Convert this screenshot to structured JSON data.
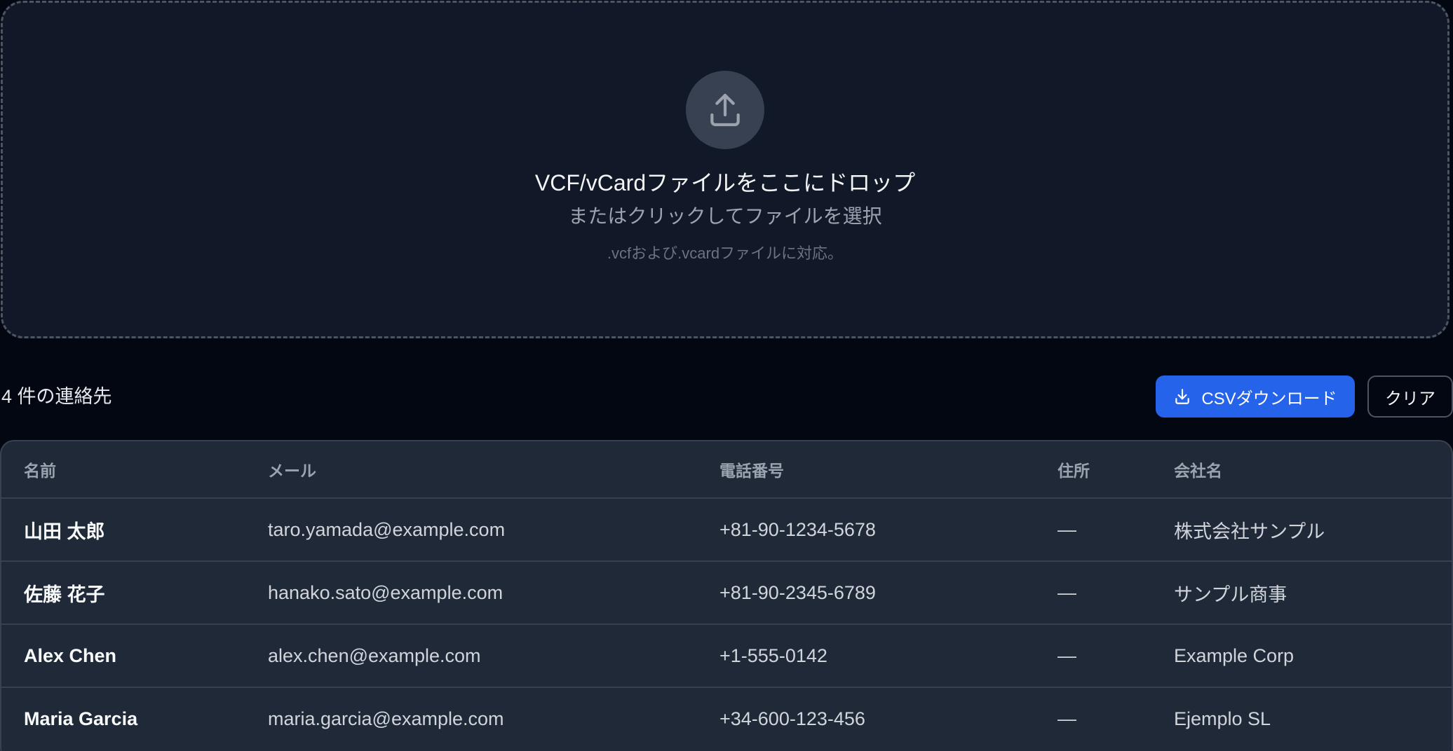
{
  "dropzone": {
    "title": "VCF/vCardファイルをここにドロップ",
    "subtitle": "またはクリックしてファイルを選択",
    "hint": ".vcfおよび.vcardファイルに対応。",
    "icon": "upload-icon"
  },
  "toolbar": {
    "count_label": "4 件の連絡先",
    "download_label": "CSVダウンロード",
    "download_icon": "download-icon",
    "clear_label": "クリア"
  },
  "table": {
    "columns": [
      "名前",
      "メール",
      "電話番号",
      "住所",
      "会社名"
    ],
    "rows": [
      {
        "name": "山田 太郎",
        "email": "taro.yamada@example.com",
        "phone": "+81-90-1234-5678",
        "address": "—",
        "company": "株式会社サンプル"
      },
      {
        "name": "佐藤 花子",
        "email": "hanako.sato@example.com",
        "phone": "+81-90-2345-6789",
        "address": "—",
        "company": "サンプル商事"
      },
      {
        "name": "Alex Chen",
        "email": "alex.chen@example.com",
        "phone": "+1-555-0142",
        "address": "—",
        "company": "Example Corp"
      },
      {
        "name": "Maria Garcia",
        "email": "maria.garcia@example.com",
        "phone": "+34-600-123-456",
        "address": "—",
        "company": "Ejemplo SL"
      }
    ]
  },
  "colors": {
    "background": "#030712",
    "panel": "#111827",
    "table": "#1f2937",
    "accent": "#2563eb"
  }
}
